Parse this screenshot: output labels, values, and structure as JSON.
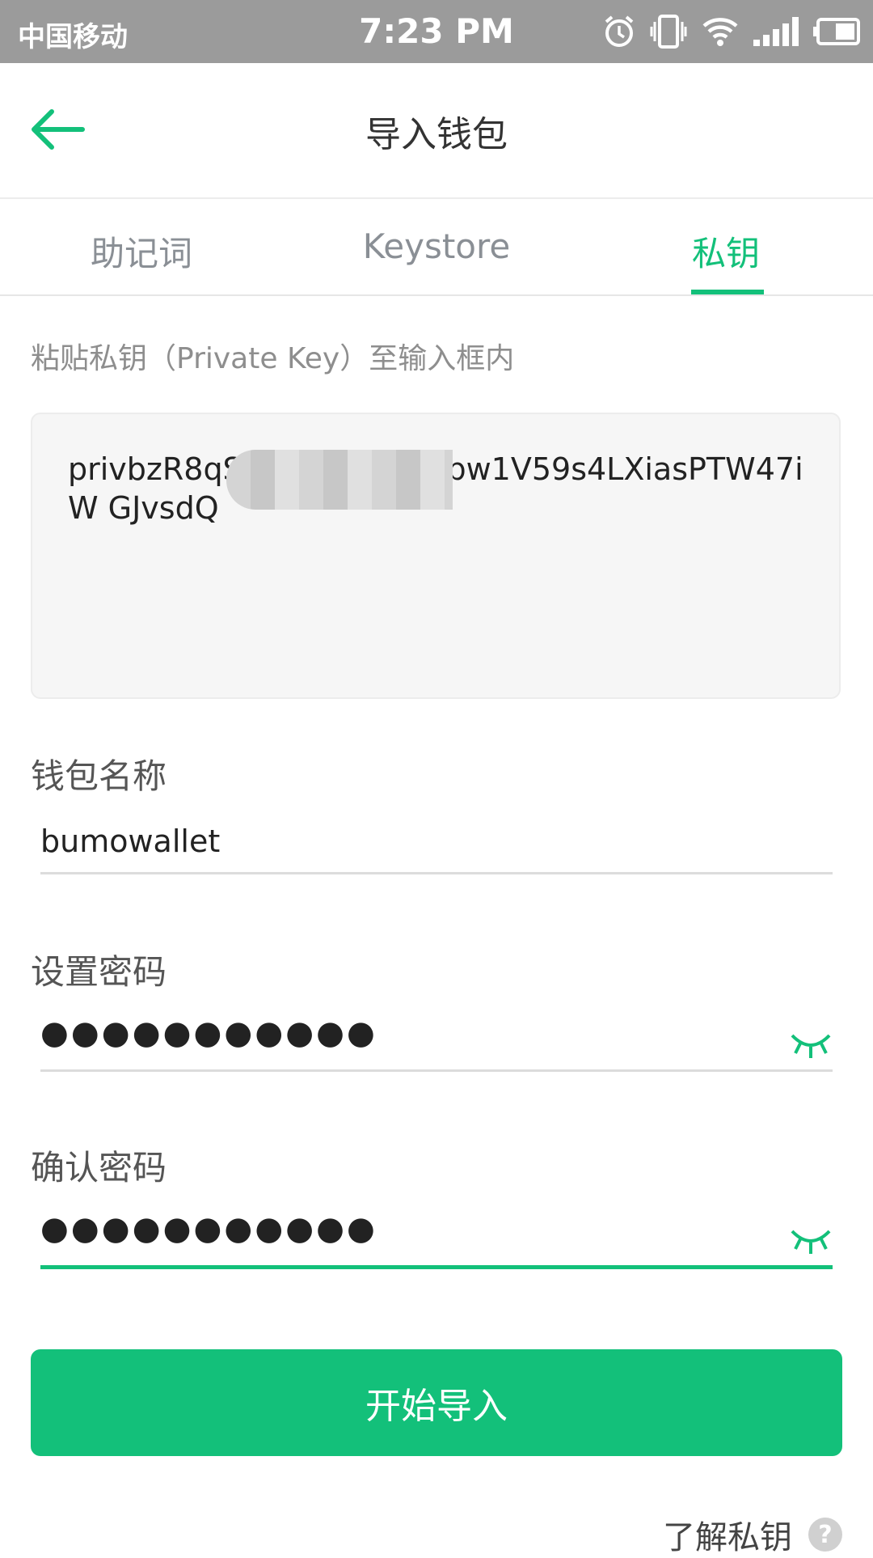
{
  "status_bar": {
    "carrier": "中国移动",
    "time": "7:23 PM",
    "icons": [
      "alarm-icon",
      "vibrate-icon",
      "wifi-icon",
      "signal-icon",
      "battery-icon"
    ]
  },
  "header": {
    "title": "导入钱包",
    "back_icon": "arrow-left-icon"
  },
  "tabs": [
    {
      "label": "助记词",
      "active": false
    },
    {
      "label": "Keystore",
      "active": false
    },
    {
      "label": "私钥",
      "active": true
    }
  ],
  "private_key": {
    "hint": "粘贴私钥（Private Key）至输入框内",
    "value": "privbzR8qS                ZHvEohwm2pw1V59s4LXiasPTW47iW                GJvsdQ"
  },
  "wallet_name": {
    "label": "钱包名称",
    "value": "bumowallet"
  },
  "password": {
    "label": "设置密码",
    "value_masked": "●●●●●●●●●●●"
  },
  "confirm_password": {
    "label": "确认密码",
    "value_masked": "●●●●●●●●●●●"
  },
  "submit_button": {
    "label": "开始导入"
  },
  "learn_link": {
    "label": "了解私钥",
    "icon": "question-icon",
    "icon_text": "?"
  },
  "colors": {
    "accent": "#13c07a",
    "status_bar": "#9b9b9b"
  }
}
